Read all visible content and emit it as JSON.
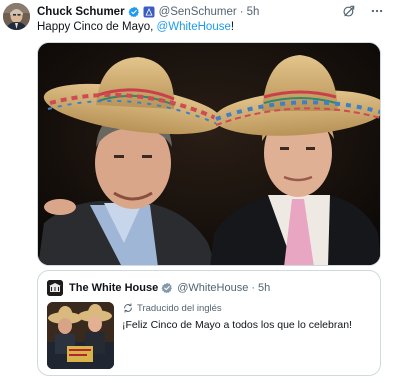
{
  "colors": {
    "text": "#0f1419",
    "secondary": "#536471",
    "link": "#1d9bf0",
    "border": "#cfd9de",
    "verified_blue": "#1d9bf0",
    "verified_gray": "#829aab"
  },
  "tweet": {
    "author_name": "Chuck Schumer",
    "handle": "@SenSchumer",
    "separator": "·",
    "time": "5h",
    "badges": [
      "verified-blue-icon",
      "us-flag-icon"
    ],
    "text_prefix": "Happy Cinco de Mayo, ",
    "text_mention": "@WhiteHouse",
    "text_suffix": "!",
    "icons": [
      "grok-icon",
      "more-icon"
    ]
  },
  "quote": {
    "author_name": "The White House",
    "handle": "@WhiteHouse",
    "separator": "·",
    "time": "5h",
    "badge": "verified-gray-icon",
    "translated_label": "Traducido del inglés",
    "text": "¡Feliz Cinco de Mayo a todos los que lo celebran!"
  }
}
